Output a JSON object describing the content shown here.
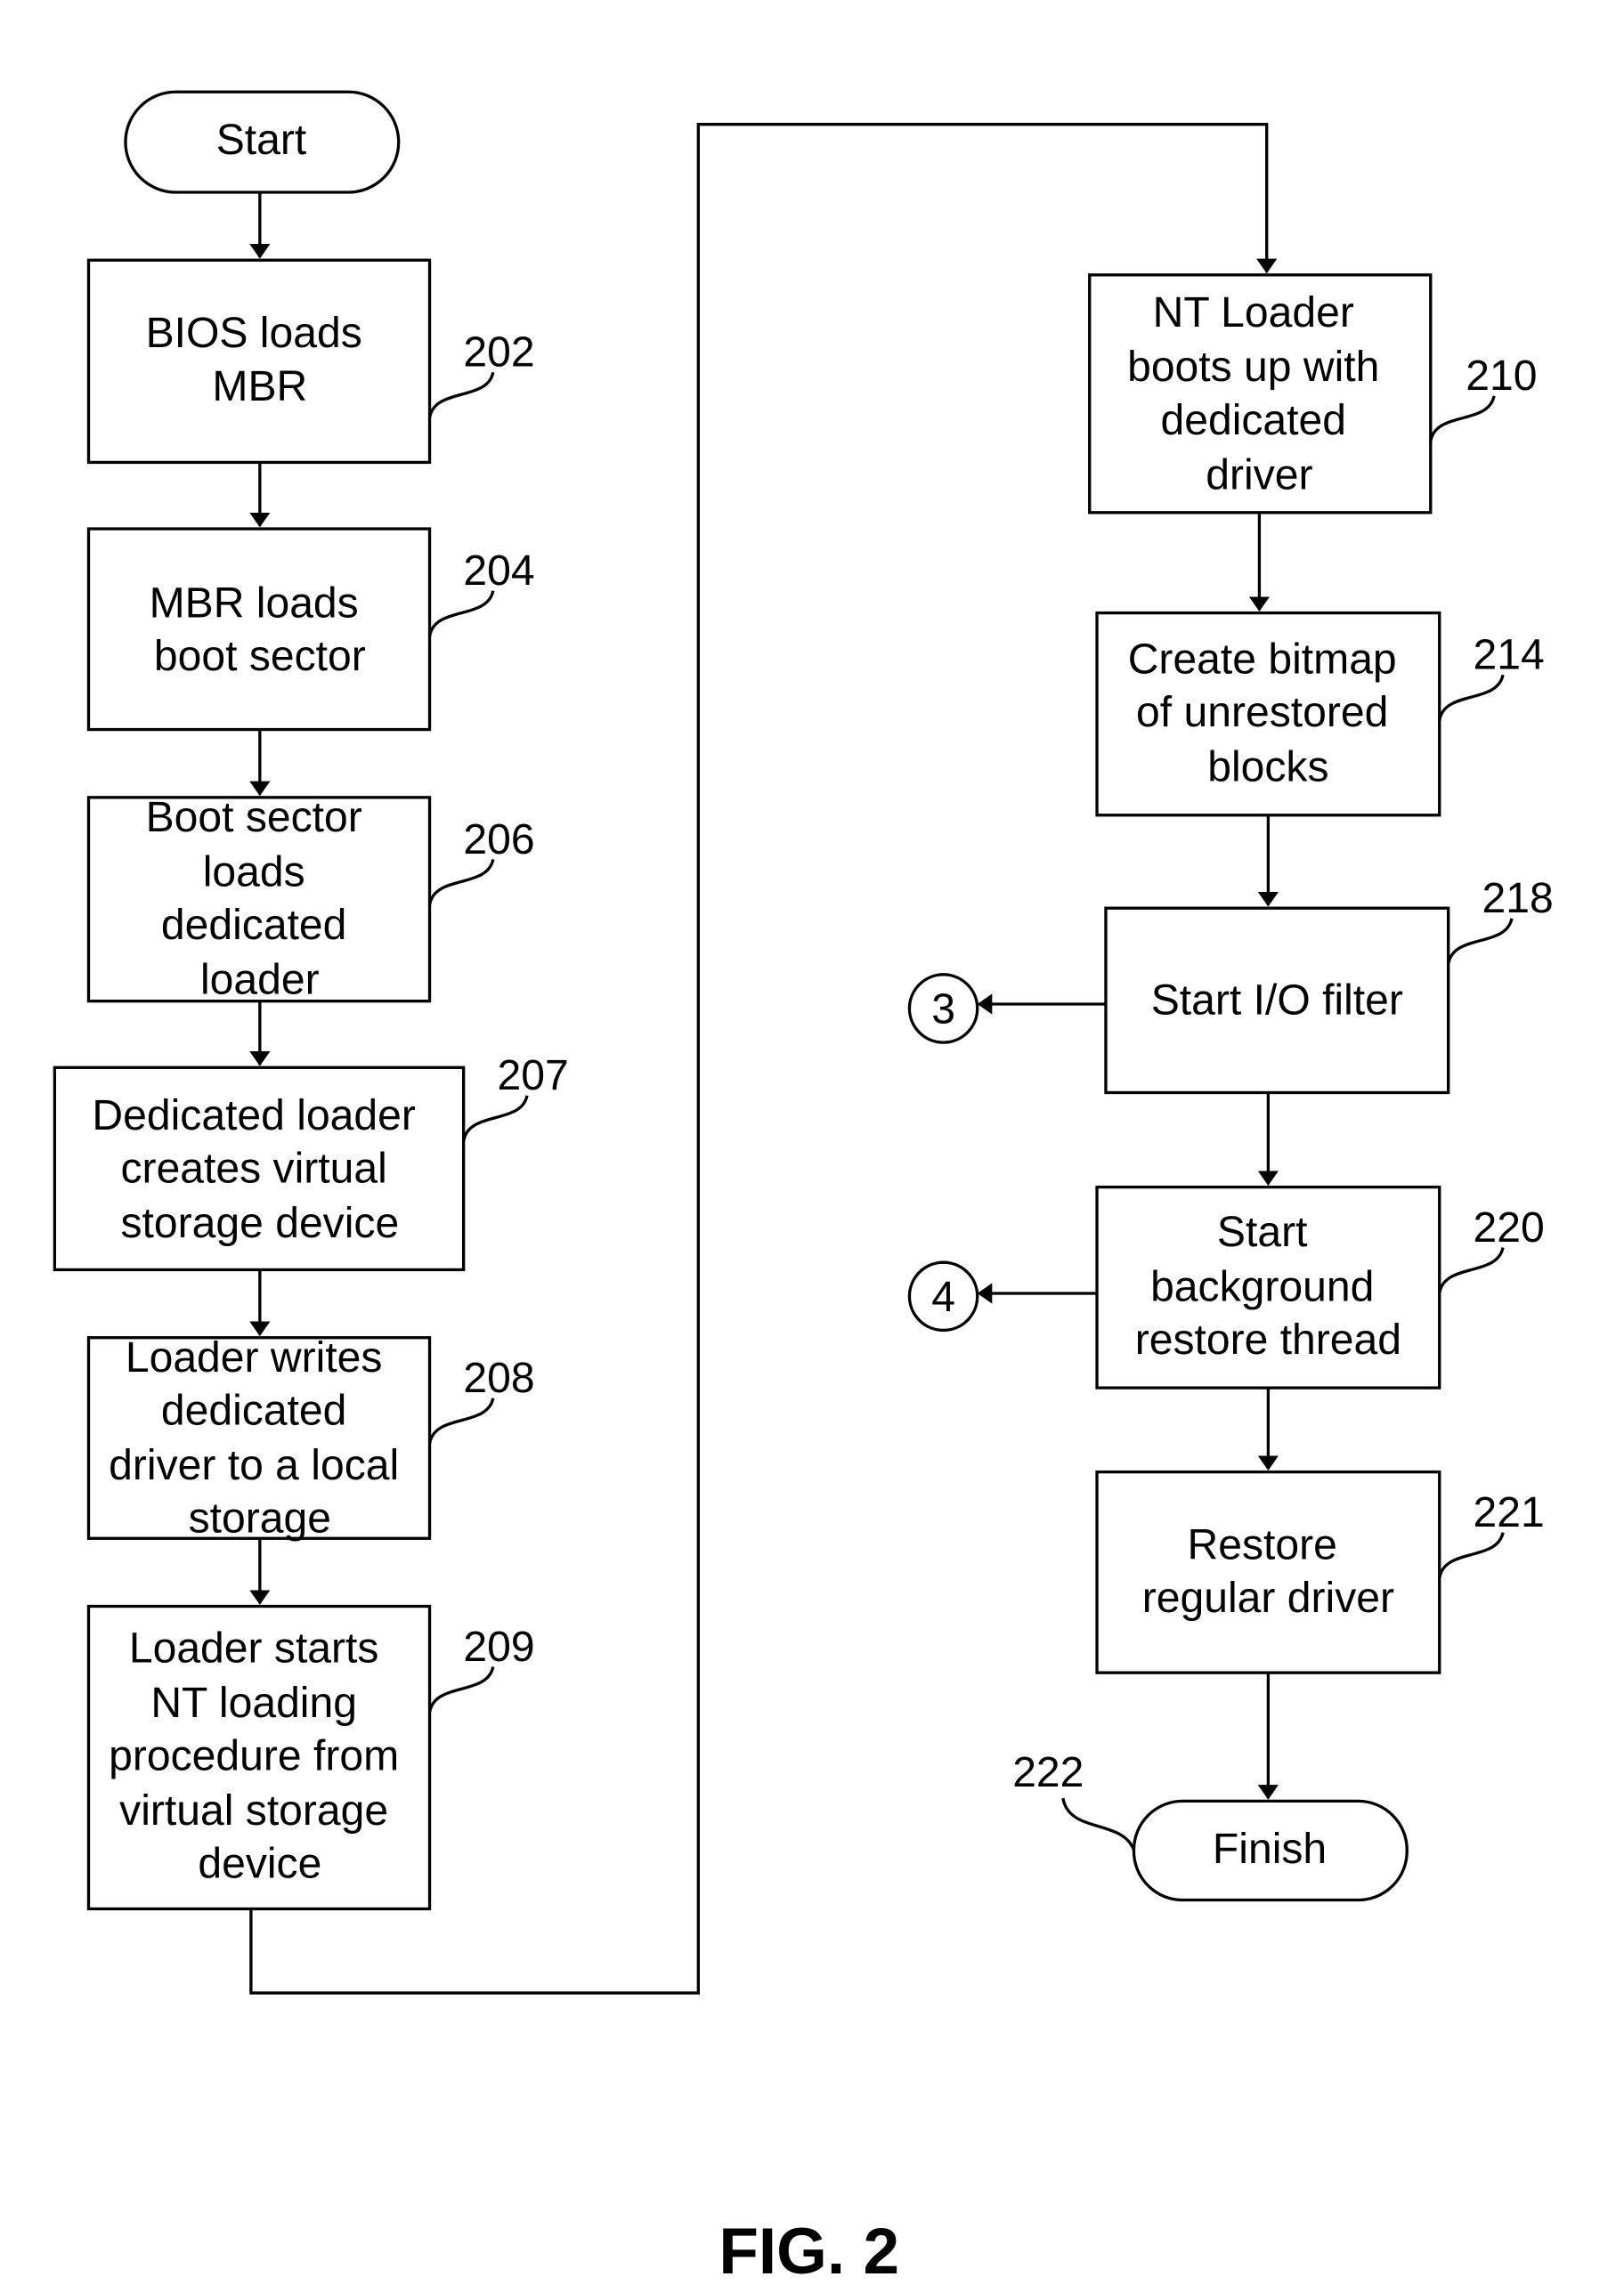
{
  "figure_title": "FIG. 2",
  "nodes": {
    "start": {
      "label": "Start"
    },
    "n202": {
      "ref": "202",
      "lines": [
        "BIOS loads",
        "MBR"
      ]
    },
    "n204": {
      "ref": "204",
      "lines": [
        "MBR loads",
        "boot sector"
      ]
    },
    "n206": {
      "ref": "206",
      "lines": [
        "Boot sector",
        "loads",
        "dedicated",
        "loader"
      ]
    },
    "n207": {
      "ref": "207",
      "lines": [
        "Dedicated loader",
        "creates virtual",
        "storage device"
      ]
    },
    "n208": {
      "ref": "208",
      "lines": [
        "Loader writes",
        "dedicated",
        "driver to a local",
        "storage"
      ]
    },
    "n209": {
      "ref": "209",
      "lines": [
        "Loader starts",
        "NT loading",
        "procedure from",
        "virtual storage",
        "device"
      ]
    },
    "n210": {
      "ref": "210",
      "lines": [
        "NT Loader",
        "boots up with",
        "dedicated",
        "driver"
      ]
    },
    "n214": {
      "ref": "214",
      "lines": [
        "Create bitmap",
        "of unrestored",
        "blocks"
      ]
    },
    "n218": {
      "ref": "218",
      "lines": [
        "Start I/O filter"
      ]
    },
    "n220": {
      "ref": "220",
      "lines": [
        "Start",
        "background",
        "restore thread"
      ]
    },
    "n221": {
      "ref": "221",
      "lines": [
        "Restore",
        "regular driver"
      ]
    },
    "finish": {
      "ref": "222",
      "label": "Finish"
    }
  },
  "connectors": {
    "c3": {
      "label": "3"
    },
    "c4": {
      "label": "4"
    }
  }
}
